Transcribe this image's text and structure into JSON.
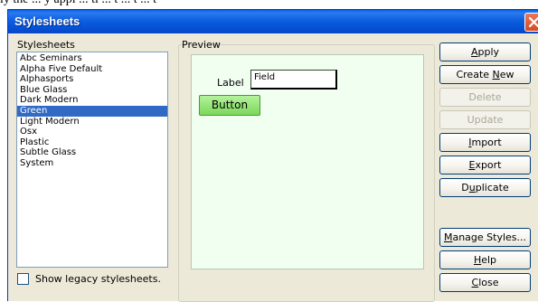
{
  "top_strip": {
    "text": "ly the ... y appl ... ti ... t ... t ... t"
  },
  "window": {
    "title": "Stylesheets"
  },
  "stylesheets_group": {
    "label": "Stylesheets",
    "items": [
      {
        "label": "Abc Seminars",
        "selected": false
      },
      {
        "label": "Alpha Five Default",
        "selected": false
      },
      {
        "label": "Alphasports",
        "selected": false
      },
      {
        "label": "Blue Glass",
        "selected": false
      },
      {
        "label": "Dark Modern",
        "selected": false
      },
      {
        "label": "Green",
        "selected": true
      },
      {
        "label": "Light Modern",
        "selected": false
      },
      {
        "label": "Osx",
        "selected": false
      },
      {
        "label": "Plastic",
        "selected": false
      },
      {
        "label": "Subtle Glass",
        "selected": false
      },
      {
        "label": "System",
        "selected": false
      }
    ]
  },
  "legacy_checkbox": {
    "label": "Show legacy stylesheets.",
    "checked": false
  },
  "preview": {
    "group_label": "Preview",
    "label_text": "Label",
    "field_value": "Field",
    "button_label": "Button"
  },
  "buttons": {
    "apply": {
      "pre": "",
      "key": "A",
      "post": "pply"
    },
    "create_new": {
      "pre": "Create ",
      "key": "N",
      "post": "ew"
    },
    "delete": {
      "pre": "",
      "key": "",
      "post": "Delete"
    },
    "update": {
      "pre": "",
      "key": "",
      "post": "Update"
    },
    "import": {
      "pre": "",
      "key": "I",
      "post": "mport"
    },
    "export": {
      "pre": "",
      "key": "E",
      "post": "xport"
    },
    "duplicate": {
      "pre": "D",
      "key": "u",
      "post": "plicate"
    },
    "manage_styles": {
      "pre": "",
      "key": "M",
      "post": "anage Styles..."
    },
    "help": {
      "pre": "",
      "key": "H",
      "post": "elp"
    },
    "close": {
      "pre": "",
      "key": "C",
      "post": "lose"
    }
  },
  "colors": {
    "titlebar": "#0554d8",
    "selection": "#316ac5",
    "preview_background": "#f0fff0",
    "preview_button": "#7bd858"
  }
}
